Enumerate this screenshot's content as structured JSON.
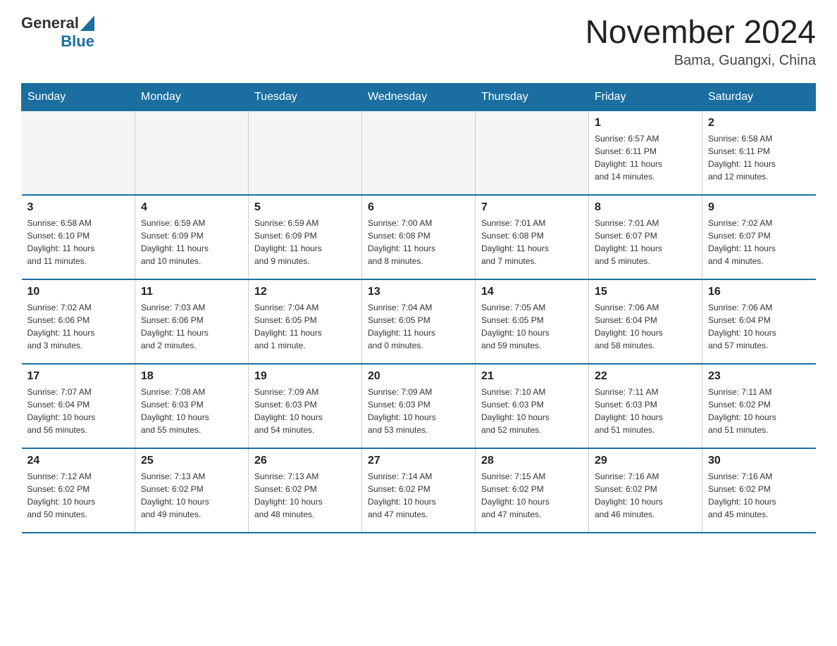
{
  "logo": {
    "text1": "General",
    "text2": "Blue"
  },
  "header": {
    "title": "November 2024",
    "location": "Bama, Guangxi, China"
  },
  "days_of_week": [
    "Sunday",
    "Monday",
    "Tuesday",
    "Wednesday",
    "Thursday",
    "Friday",
    "Saturday"
  ],
  "weeks": [
    [
      {
        "day": "",
        "info": ""
      },
      {
        "day": "",
        "info": ""
      },
      {
        "day": "",
        "info": ""
      },
      {
        "day": "",
        "info": ""
      },
      {
        "day": "",
        "info": ""
      },
      {
        "day": "1",
        "info": "Sunrise: 6:57 AM\nSunset: 6:11 PM\nDaylight: 11 hours\nand 14 minutes."
      },
      {
        "day": "2",
        "info": "Sunrise: 6:58 AM\nSunset: 6:11 PM\nDaylight: 11 hours\nand 12 minutes."
      }
    ],
    [
      {
        "day": "3",
        "info": "Sunrise: 6:58 AM\nSunset: 6:10 PM\nDaylight: 11 hours\nand 11 minutes."
      },
      {
        "day": "4",
        "info": "Sunrise: 6:59 AM\nSunset: 6:09 PM\nDaylight: 11 hours\nand 10 minutes."
      },
      {
        "day": "5",
        "info": "Sunrise: 6:59 AM\nSunset: 6:09 PM\nDaylight: 11 hours\nand 9 minutes."
      },
      {
        "day": "6",
        "info": "Sunrise: 7:00 AM\nSunset: 6:08 PM\nDaylight: 11 hours\nand 8 minutes."
      },
      {
        "day": "7",
        "info": "Sunrise: 7:01 AM\nSunset: 6:08 PM\nDaylight: 11 hours\nand 7 minutes."
      },
      {
        "day": "8",
        "info": "Sunrise: 7:01 AM\nSunset: 6:07 PM\nDaylight: 11 hours\nand 5 minutes."
      },
      {
        "day": "9",
        "info": "Sunrise: 7:02 AM\nSunset: 6:07 PM\nDaylight: 11 hours\nand 4 minutes."
      }
    ],
    [
      {
        "day": "10",
        "info": "Sunrise: 7:02 AM\nSunset: 6:06 PM\nDaylight: 11 hours\nand 3 minutes."
      },
      {
        "day": "11",
        "info": "Sunrise: 7:03 AM\nSunset: 6:06 PM\nDaylight: 11 hours\nand 2 minutes."
      },
      {
        "day": "12",
        "info": "Sunrise: 7:04 AM\nSunset: 6:05 PM\nDaylight: 11 hours\nand 1 minute."
      },
      {
        "day": "13",
        "info": "Sunrise: 7:04 AM\nSunset: 6:05 PM\nDaylight: 11 hours\nand 0 minutes."
      },
      {
        "day": "14",
        "info": "Sunrise: 7:05 AM\nSunset: 6:05 PM\nDaylight: 10 hours\nand 59 minutes."
      },
      {
        "day": "15",
        "info": "Sunrise: 7:06 AM\nSunset: 6:04 PM\nDaylight: 10 hours\nand 58 minutes."
      },
      {
        "day": "16",
        "info": "Sunrise: 7:06 AM\nSunset: 6:04 PM\nDaylight: 10 hours\nand 57 minutes."
      }
    ],
    [
      {
        "day": "17",
        "info": "Sunrise: 7:07 AM\nSunset: 6:04 PM\nDaylight: 10 hours\nand 56 minutes."
      },
      {
        "day": "18",
        "info": "Sunrise: 7:08 AM\nSunset: 6:03 PM\nDaylight: 10 hours\nand 55 minutes."
      },
      {
        "day": "19",
        "info": "Sunrise: 7:09 AM\nSunset: 6:03 PM\nDaylight: 10 hours\nand 54 minutes."
      },
      {
        "day": "20",
        "info": "Sunrise: 7:09 AM\nSunset: 6:03 PM\nDaylight: 10 hours\nand 53 minutes."
      },
      {
        "day": "21",
        "info": "Sunrise: 7:10 AM\nSunset: 6:03 PM\nDaylight: 10 hours\nand 52 minutes."
      },
      {
        "day": "22",
        "info": "Sunrise: 7:11 AM\nSunset: 6:03 PM\nDaylight: 10 hours\nand 51 minutes."
      },
      {
        "day": "23",
        "info": "Sunrise: 7:11 AM\nSunset: 6:02 PM\nDaylight: 10 hours\nand 51 minutes."
      }
    ],
    [
      {
        "day": "24",
        "info": "Sunrise: 7:12 AM\nSunset: 6:02 PM\nDaylight: 10 hours\nand 50 minutes."
      },
      {
        "day": "25",
        "info": "Sunrise: 7:13 AM\nSunset: 6:02 PM\nDaylight: 10 hours\nand 49 minutes."
      },
      {
        "day": "26",
        "info": "Sunrise: 7:13 AM\nSunset: 6:02 PM\nDaylight: 10 hours\nand 48 minutes."
      },
      {
        "day": "27",
        "info": "Sunrise: 7:14 AM\nSunset: 6:02 PM\nDaylight: 10 hours\nand 47 minutes."
      },
      {
        "day": "28",
        "info": "Sunrise: 7:15 AM\nSunset: 6:02 PM\nDaylight: 10 hours\nand 47 minutes."
      },
      {
        "day": "29",
        "info": "Sunrise: 7:16 AM\nSunset: 6:02 PM\nDaylight: 10 hours\nand 46 minutes."
      },
      {
        "day": "30",
        "info": "Sunrise: 7:16 AM\nSunset: 6:02 PM\nDaylight: 10 hours\nand 45 minutes."
      }
    ]
  ]
}
